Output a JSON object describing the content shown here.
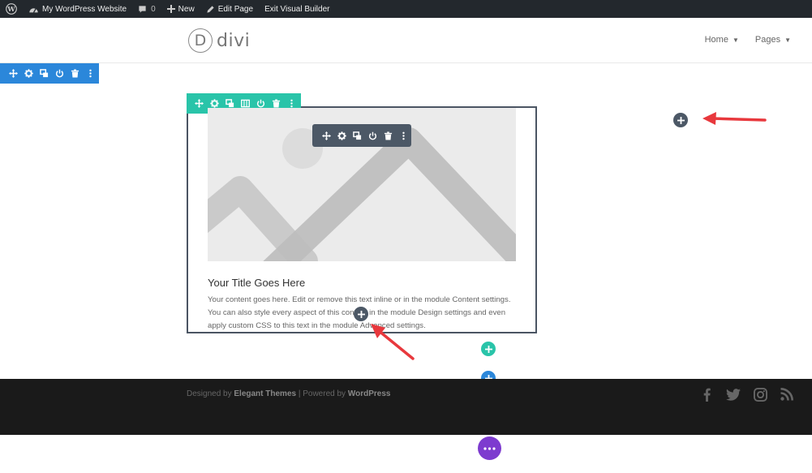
{
  "adminbar": {
    "site_name": "My WordPress Website",
    "comments_count": "0",
    "new_label": "New",
    "edit_page_label": "Edit Page",
    "exit_label": "Exit Visual Builder"
  },
  "header": {
    "logo_letter": "D",
    "logo_word": "divi",
    "nav": [
      {
        "label": "Home"
      },
      {
        "label": "Pages"
      }
    ]
  },
  "toolbars": {
    "section": [
      "move-icon",
      "gear-icon",
      "duplicate-icon",
      "power-icon",
      "trash-icon",
      "more-icon"
    ],
    "row": [
      "move-icon",
      "gear-icon",
      "duplicate-icon",
      "columns-icon",
      "power-icon",
      "trash-icon",
      "more-icon"
    ],
    "module": [
      "move-icon",
      "gear-icon",
      "duplicate-icon",
      "power-icon",
      "trash-icon",
      "more-icon"
    ]
  },
  "module": {
    "title": "Your Title Goes Here",
    "body": "Your content goes here. Edit or remove this text inline or in the module Content settings. You can also style every aspect of this content in the module Design settings and even apply custom CSS to this text in the module Advanced settings."
  },
  "footer": {
    "credits_prefix": "Designed by ",
    "credits_brand1": "Elegant Themes",
    "credits_mid": " | Powered by ",
    "credits_brand2": "WordPress",
    "social": [
      "facebook-icon",
      "twitter-icon",
      "instagram-icon",
      "rss-icon"
    ]
  },
  "colors": {
    "admin_bar": "#23282d",
    "section_blue": "#2b87da",
    "row_teal": "#29c4a9",
    "module_dark": "#4c5866",
    "settings_purple": "#7d3bcf",
    "arrow_red": "#e8383d"
  }
}
